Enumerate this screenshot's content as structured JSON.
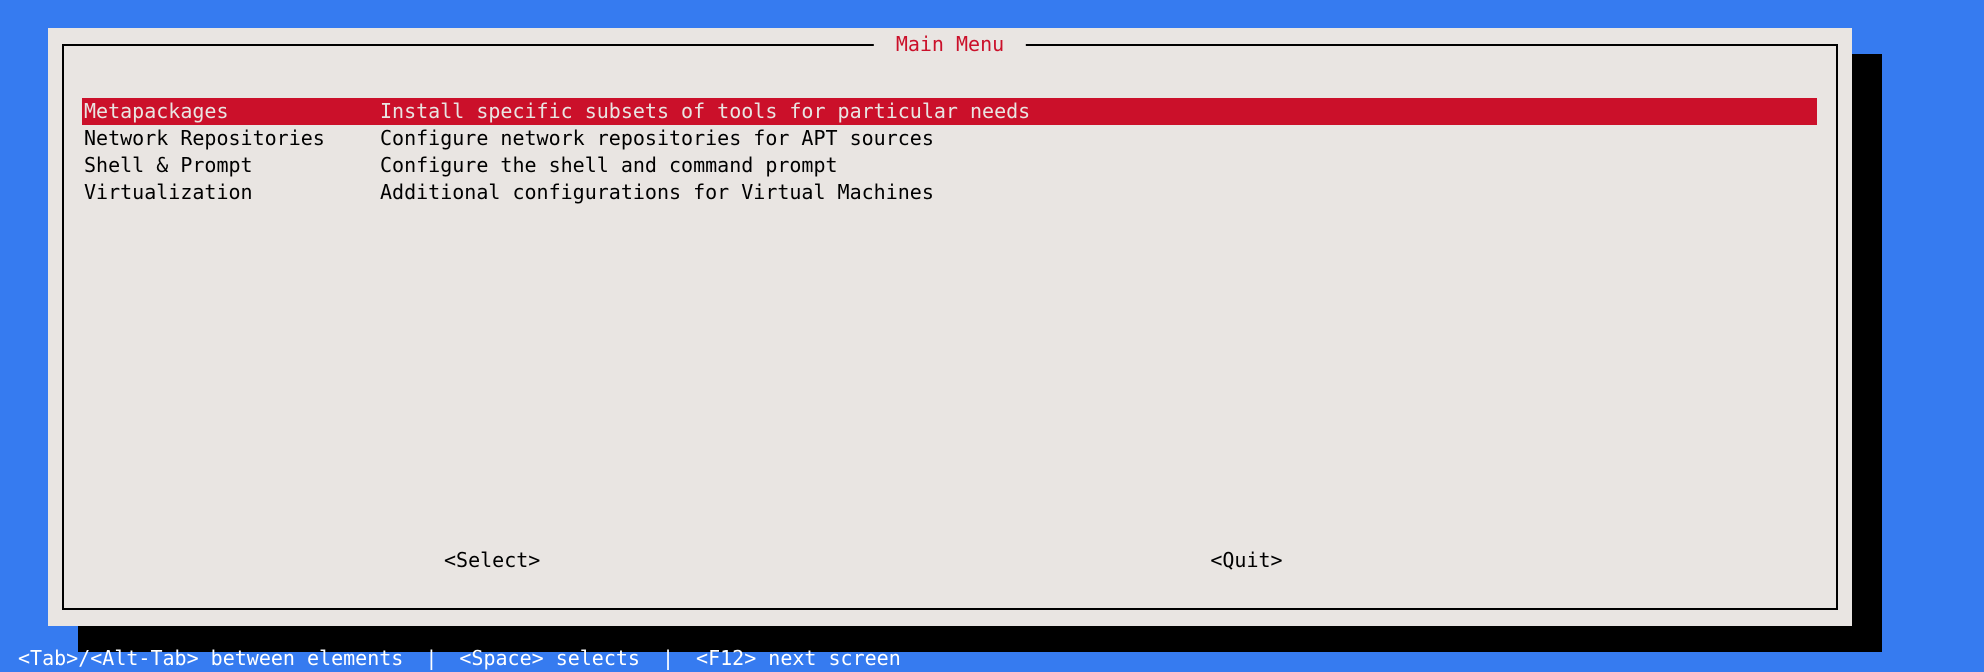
{
  "dialog": {
    "title": "Main Menu",
    "items": [
      {
        "label": "Metapackages",
        "desc": "Install specific subsets of tools for particular needs",
        "selected": true
      },
      {
        "label": "Network Repositories",
        "desc": "Configure network repositories for APT sources",
        "selected": false
      },
      {
        "label": "Shell & Prompt",
        "desc": "Configure the shell and command prompt",
        "selected": false
      },
      {
        "label": "Virtualization",
        "desc": "Additional configurations for Virtual Machines",
        "selected": false
      }
    ],
    "buttons": {
      "select": "<Select>",
      "quit": "<Quit>"
    }
  },
  "footer": {
    "hint_tab": "<Tab>/<Alt-Tab> between elements",
    "hint_space": "<Space> selects",
    "hint_f12": "<F12> next screen",
    "separator": "|"
  }
}
